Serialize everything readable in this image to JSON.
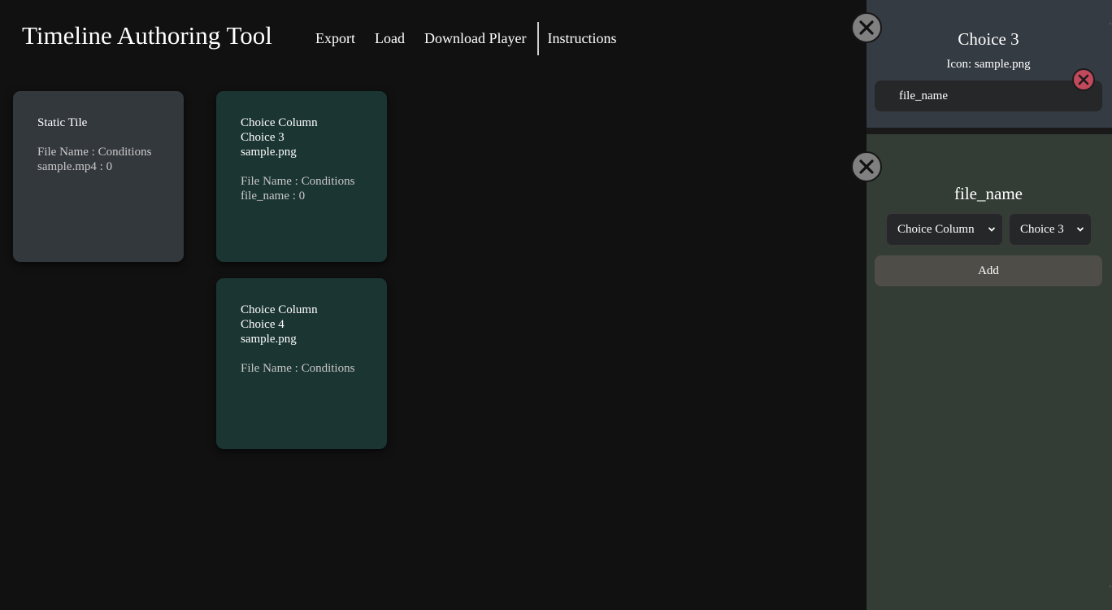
{
  "app": {
    "title": "Timeline Authoring Tool"
  },
  "nav": {
    "export": "Export",
    "load": "Load",
    "download_player": "Download Player",
    "instructions": "Instructions"
  },
  "tiles": [
    {
      "head": [
        "Static Tile"
      ],
      "body": [
        "File Name : Conditions",
        "sample.mp4 : 0"
      ]
    },
    {
      "head": [
        "Choice Column",
        "Choice 3",
        "sample.png"
      ],
      "body": [
        "File Name : Conditions",
        "file_name : 0"
      ]
    },
    {
      "head": [
        "Choice Column",
        "Choice 4",
        "sample.png"
      ],
      "body": [
        "File Name : Conditions"
      ]
    }
  ],
  "panel": {
    "title": "Choice 3",
    "icon_line": "Icon: sample.png",
    "condition_item": "file_name",
    "condition_heading": "file_name",
    "column_select": "Choice Column",
    "choice_select": "Choice 3",
    "add_label": "Add"
  },
  "colors": {
    "background": "#111111",
    "static_tile": "#33383d",
    "choice_tile": "#1b3532",
    "panel": "#343d35",
    "panel_top": "#343b43",
    "remove": "#c2485c",
    "close": "#808080"
  },
  "icons": {
    "close": "x-circle-icon",
    "remove": "x-circle-icon",
    "dropdown": "chevron-down-icon"
  }
}
